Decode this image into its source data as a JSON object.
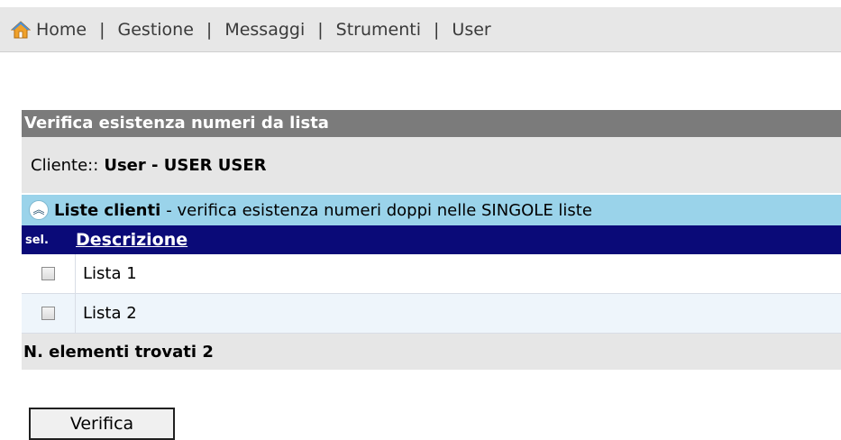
{
  "nav": {
    "items": [
      {
        "label": "Home"
      },
      {
        "label": "Gestione"
      },
      {
        "label": "Messaggi"
      },
      {
        "label": "Strumenti"
      },
      {
        "label": "User"
      }
    ],
    "separator": "|"
  },
  "panel": {
    "title": "Verifica esistenza numeri da lista",
    "cliente_label": "Cliente::",
    "cliente_value": "User - USER USER",
    "section_title": "Liste clienti",
    "section_desc": "- verifica esistenza numeri doppi nelle SINGOLE liste",
    "table": {
      "col_sel": "sel.",
      "col_desc": "Descrizione",
      "rows": [
        {
          "label": "Lista 1",
          "checked": false
        },
        {
          "label": "Lista 2",
          "checked": false
        }
      ]
    },
    "footer": "N. elementi trovati 2"
  },
  "actions": {
    "verify_label": "Verifica"
  }
}
